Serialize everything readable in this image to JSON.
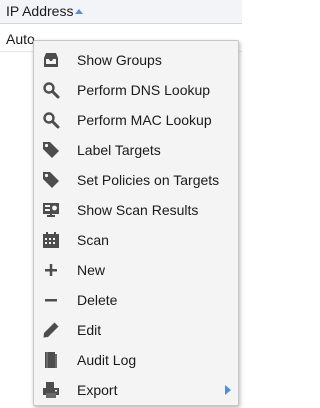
{
  "grid": {
    "column_header": "IP Address",
    "sort_icon": "sort-ascending-icon",
    "row_value": "Auto"
  },
  "context_menu": {
    "items": [
      {
        "label": "Show Groups",
        "icon": "inbox-icon"
      },
      {
        "label": "Perform DNS Lookup",
        "icon": "magnifier-icon"
      },
      {
        "label": "Perform MAC Lookup",
        "icon": "magnifier-icon"
      },
      {
        "label": "Label Targets",
        "icon": "tag-icon"
      },
      {
        "label": "Set Policies on Targets",
        "icon": "tag-icon"
      },
      {
        "label": "Show Scan Results",
        "icon": "scan-results-icon"
      },
      {
        "label": "Scan",
        "icon": "calendar-icon"
      },
      {
        "label": "New",
        "icon": "plus-icon"
      },
      {
        "label": "Delete",
        "icon": "minus-icon"
      },
      {
        "label": "Edit",
        "icon": "pencil-icon"
      },
      {
        "label": "Audit Log",
        "icon": "book-icon"
      },
      {
        "label": "Export",
        "icon": "export-icon",
        "submenu": true
      }
    ]
  },
  "colors": {
    "icon": "#4d4d4d",
    "accent": "#4a90e2",
    "menu_background": "#f4f4f4"
  }
}
